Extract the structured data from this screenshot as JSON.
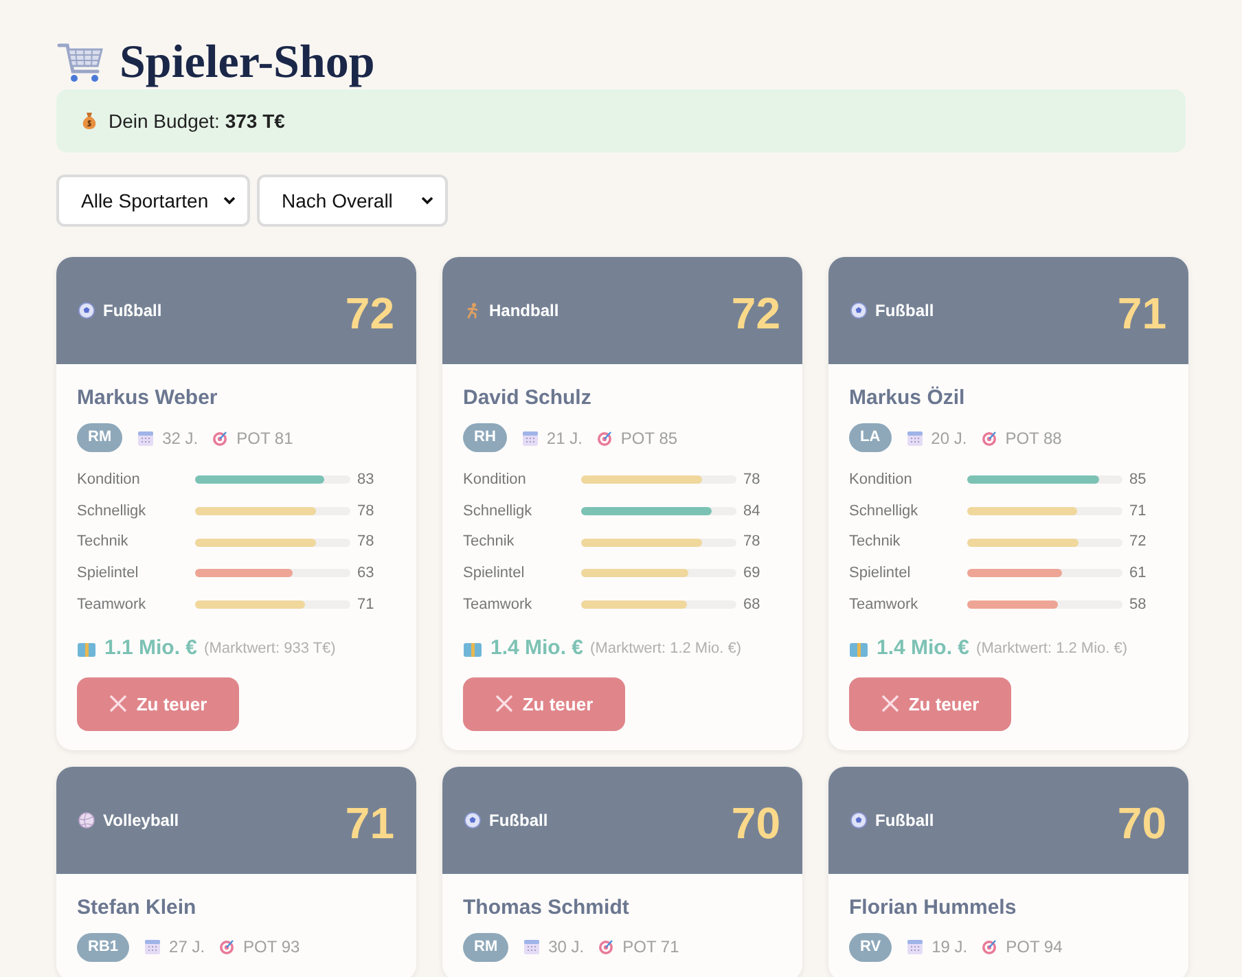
{
  "title": "Spieler-Shop",
  "budget": {
    "label": "Dein Budget:",
    "value": "373 T€"
  },
  "filters": [
    {
      "value": "Alle Sportarten"
    },
    {
      "value": "Nach Overall"
    }
  ],
  "players": [
    {
      "sport": {
        "kind": "soccer",
        "label": "Fußball"
      },
      "overall": "72",
      "name": "Markus Weber",
      "position": "RM",
      "age": "32 J.",
      "potential": "POT 81",
      "stats": [
        {
          "label": "Kondition",
          "level": 0.83,
          "value": "83"
        },
        {
          "label": "Schnelligk",
          "level": 0.78,
          "value": "78"
        },
        {
          "label": "Technik",
          "level": 0.78,
          "value": "78"
        },
        {
          "label": "Spielintel",
          "level": 0.63,
          "value": "63"
        },
        {
          "label": "Teamwork",
          "level": 0.71,
          "value": "71"
        }
      ],
      "price": "1.1 Mio. €",
      "market_value": "(Marktwert: 933 T€)",
      "button": {
        "label": "Zu teuer",
        "disabled": true
      }
    },
    {
      "sport": {
        "kind": "handball",
        "label": "Handball"
      },
      "overall": "72",
      "name": "David Schulz",
      "position": "RH",
      "age": "21 J.",
      "potential": "POT 85",
      "stats": [
        {
          "label": "Kondition",
          "level": 0.78,
          "value": "78"
        },
        {
          "label": "Schnelligk",
          "level": 0.84,
          "value": "84"
        },
        {
          "label": "Technik",
          "level": 0.78,
          "value": "78"
        },
        {
          "label": "Spielintel",
          "level": 0.69,
          "value": "69"
        },
        {
          "label": "Teamwork",
          "level": 0.68,
          "value": "68"
        }
      ],
      "price": "1.4 Mio. €",
      "market_value": "(Marktwert: 1.2 Mio. €)",
      "button": {
        "label": "Zu teuer",
        "disabled": true
      }
    },
    {
      "sport": {
        "kind": "soccer",
        "label": "Fußball"
      },
      "overall": "71",
      "name": "Markus Özil",
      "position": "LA",
      "age": "20 J.",
      "potential": "POT 88",
      "stats": [
        {
          "label": "Kondition",
          "level": 0.85,
          "value": "85"
        },
        {
          "label": "Schnelligk",
          "level": 0.71,
          "value": "71"
        },
        {
          "label": "Technik",
          "level": 0.72,
          "value": "72"
        },
        {
          "label": "Spielintel",
          "level": 0.61,
          "value": "61"
        },
        {
          "label": "Teamwork",
          "level": 0.58,
          "value": "58"
        }
      ],
      "price": "1.4 Mio. €",
      "market_value": "(Marktwert: 1.2 Mio. €)",
      "button": {
        "label": "Zu teuer",
        "disabled": true
      }
    },
    {
      "sport": {
        "kind": "volleyball",
        "label": "Volleyball"
      },
      "overall": "71",
      "name": "Stefan Klein",
      "position": "RB1",
      "age": "27 J.",
      "potential": "POT 93"
    },
    {
      "sport": {
        "kind": "soccer",
        "label": "Fußball"
      },
      "overall": "70",
      "name": "Thomas Schmidt",
      "position": "RM",
      "age": "30 J.",
      "potential": "POT 71"
    },
    {
      "sport": {
        "kind": "soccer",
        "label": "Fußball"
      },
      "overall": "70",
      "name": "Florian Hummels",
      "position": "RV",
      "age": "19 J.",
      "potential": "POT 94"
    }
  ]
}
